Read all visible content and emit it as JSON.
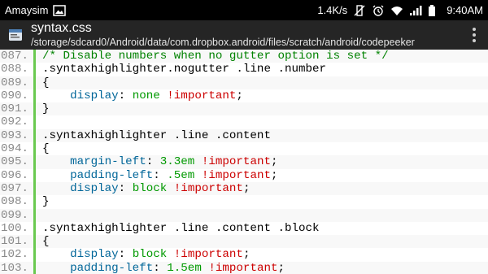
{
  "status_bar": {
    "carrier": "Amaysim",
    "speed": "1.4K/s",
    "time": "9:40AM"
  },
  "app_bar": {
    "title": "syntax.css",
    "path": "/storage/sdcard0/Android/data/com.dropbox.android/files/scratch/android/codepeeker"
  },
  "code": {
    "lines": [
      {
        "num": "087.",
        "tokens": [
          {
            "t": "comment",
            "v": "/* Disable numbers when no gutter option is set */"
          }
        ]
      },
      {
        "num": "088.",
        "tokens": [
          {
            "t": "selector",
            "v": ".syntaxhighlighter.nogutter .line .number"
          }
        ]
      },
      {
        "num": "089.",
        "tokens": [
          {
            "t": "punct",
            "v": "{"
          }
        ]
      },
      {
        "num": "090.",
        "tokens": [
          {
            "t": "indent",
            "v": "    "
          },
          {
            "t": "prop",
            "v": "display"
          },
          {
            "t": "punct",
            "v": ": "
          },
          {
            "t": "value",
            "v": "none"
          },
          {
            "t": "punct",
            "v": " "
          },
          {
            "t": "important",
            "v": "!important"
          },
          {
            "t": "punct",
            "v": ";"
          }
        ]
      },
      {
        "num": "091.",
        "tokens": [
          {
            "t": "punct",
            "v": "}"
          }
        ]
      },
      {
        "num": "092.",
        "tokens": []
      },
      {
        "num": "093.",
        "tokens": [
          {
            "t": "selector",
            "v": ".syntaxhighlighter .line .content"
          }
        ]
      },
      {
        "num": "094.",
        "tokens": [
          {
            "t": "punct",
            "v": "{"
          }
        ]
      },
      {
        "num": "095.",
        "tokens": [
          {
            "t": "indent",
            "v": "    "
          },
          {
            "t": "prop",
            "v": "margin-left"
          },
          {
            "t": "punct",
            "v": ": "
          },
          {
            "t": "value",
            "v": "3.3em"
          },
          {
            "t": "punct",
            "v": " "
          },
          {
            "t": "important",
            "v": "!important"
          },
          {
            "t": "punct",
            "v": ";"
          }
        ]
      },
      {
        "num": "096.",
        "tokens": [
          {
            "t": "indent",
            "v": "    "
          },
          {
            "t": "prop",
            "v": "padding-left"
          },
          {
            "t": "punct",
            "v": ": "
          },
          {
            "t": "value",
            "v": ".5em"
          },
          {
            "t": "punct",
            "v": " "
          },
          {
            "t": "important",
            "v": "!important"
          },
          {
            "t": "punct",
            "v": ";"
          }
        ]
      },
      {
        "num": "097.",
        "tokens": [
          {
            "t": "indent",
            "v": "    "
          },
          {
            "t": "prop",
            "v": "display"
          },
          {
            "t": "punct",
            "v": ": "
          },
          {
            "t": "value",
            "v": "block"
          },
          {
            "t": "punct",
            "v": " "
          },
          {
            "t": "important",
            "v": "!important"
          },
          {
            "t": "punct",
            "v": ";"
          }
        ]
      },
      {
        "num": "098.",
        "tokens": [
          {
            "t": "punct",
            "v": "}"
          }
        ]
      },
      {
        "num": "099.",
        "tokens": []
      },
      {
        "num": "100.",
        "tokens": [
          {
            "t": "selector",
            "v": ".syntaxhighlighter .line .content .block"
          }
        ]
      },
      {
        "num": "101.",
        "tokens": [
          {
            "t": "punct",
            "v": "{"
          }
        ]
      },
      {
        "num": "102.",
        "tokens": [
          {
            "t": "indent",
            "v": "    "
          },
          {
            "t": "prop",
            "v": "display"
          },
          {
            "t": "punct",
            "v": ": "
          },
          {
            "t": "value",
            "v": "block"
          },
          {
            "t": "punct",
            "v": " "
          },
          {
            "t": "important",
            "v": "!important"
          },
          {
            "t": "punct",
            "v": ";"
          }
        ]
      },
      {
        "num": "103.",
        "tokens": [
          {
            "t": "indent",
            "v": "    "
          },
          {
            "t": "prop",
            "v": "padding-left"
          },
          {
            "t": "punct",
            "v": ": "
          },
          {
            "t": "value",
            "v": "1.5em"
          },
          {
            "t": "punct",
            "v": " "
          },
          {
            "t": "important",
            "v": "!important"
          },
          {
            "t": "punct",
            "v": ";"
          }
        ]
      }
    ]
  },
  "colors": {
    "gutter_bar": "#6ac950",
    "comment": "#008200",
    "property": "#006699",
    "value": "#009900",
    "important": "#cc0000"
  }
}
